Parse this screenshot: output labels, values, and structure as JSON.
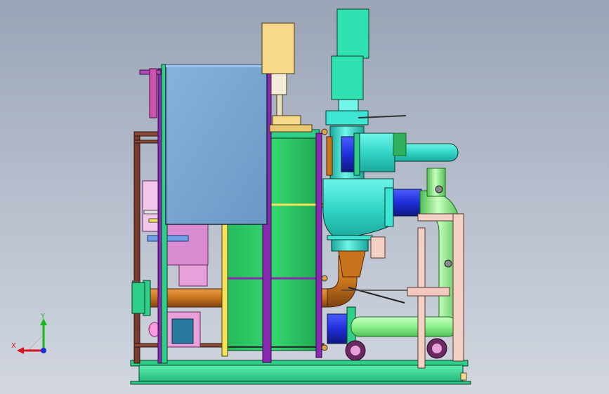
{
  "viewport": {
    "background_top": "#9aa4b6",
    "background_bottom": "#d2d7df"
  },
  "triad": {
    "x_label": "X",
    "y_label": "Y",
    "x_color": "#d8141c",
    "y_color": "#1bb81b",
    "z_color": "#1f2fd8"
  },
  "model": {
    "description_colors": {
      "frame": "#7a3a2c",
      "panel": "#7aa6d2",
      "heat_exchanger": "#2fcf6a",
      "pipe_cyan": "#3ee6d6",
      "pipe_green": "#8cf28c",
      "pipe_orange": "#c8741c",
      "valve_blue": "#1f2fd8",
      "motor_yellow": "#f7d98a",
      "actuator_teal": "#2fe0b0",
      "base": "#2fcf8a",
      "purple": "#8a2ab2",
      "pink": "#e8a0d8"
    }
  }
}
